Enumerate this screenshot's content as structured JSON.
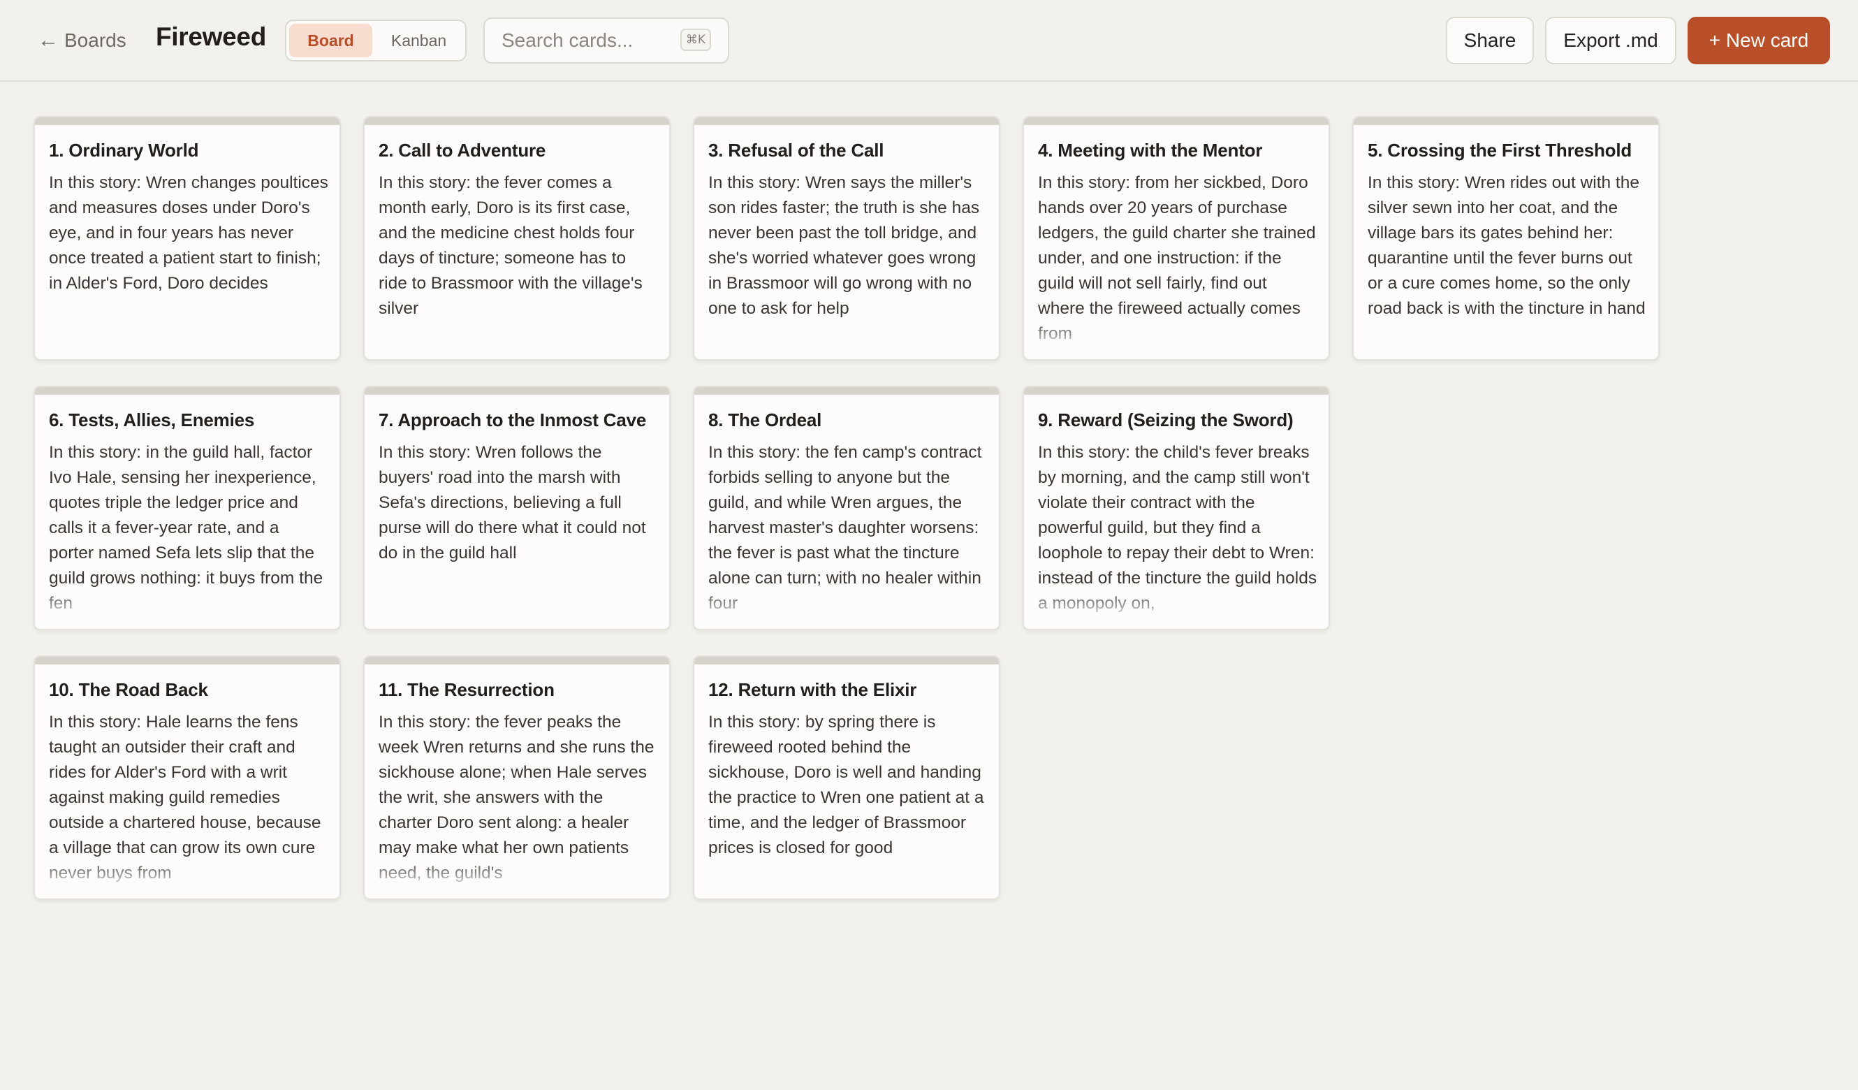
{
  "header": {
    "back_label": "Boards",
    "back_arrow": "←",
    "title": "Fireweed",
    "views": [
      {
        "label": "Board",
        "active": true
      },
      {
        "label": "Kanban",
        "active": false
      }
    ],
    "search_placeholder": "Search cards...",
    "search_shortcut": "⌘K",
    "share_label": "Share",
    "export_label": "Export .md",
    "new_card_label": "+ New card"
  },
  "colors": {
    "accent": "#b94f29",
    "accent_soft": "#f7dccf",
    "background": "#f3f1ed",
    "card": "#fdfcfa",
    "card_stripe": "#d6d3cd"
  },
  "cards": [
    {
      "title": "1. Ordinary World",
      "body": "In this story: Wren changes poultices and measures doses under Doro's eye, and in four years has never once treated a patient start to finish; in Alder's Ford, Doro decides"
    },
    {
      "title": "2. Call to Adventure",
      "body": "In this story: the fever comes a month early, Doro is its first case, and the medicine chest holds four days of tincture; someone has to ride to Brassmoor with the village's silver"
    },
    {
      "title": "3. Refusal of the Call",
      "body": "In this story: Wren says the miller's son rides faster; the truth is she has never been past the toll bridge, and she's worried whatever goes wrong in Brassmoor will go wrong with no one to ask for help"
    },
    {
      "title": "4. Meeting with the Mentor",
      "body": "In this story: from her sickbed, Doro hands over 20 years of purchase ledgers, the guild charter she trained under, and one instruction: if the guild will not sell fairly, find out where the fireweed actually comes from"
    },
    {
      "title": "5. Crossing the First Threshold",
      "body": "In this story: Wren rides out with the silver sewn into her coat, and the village bars its gates behind her: quarantine until the fever burns out or a cure comes home, so the only road back is with the tincture in hand"
    },
    {
      "title": "6. Tests, Allies, Enemies",
      "body": "In this story: in the guild hall, factor Ivo Hale, sensing her inexperience, quotes triple the ledger price and calls it a fever-year rate, and a porter named Sefa lets slip that the guild grows nothing: it buys from the fen"
    },
    {
      "title": "7. Approach to the Inmost Cave",
      "body": "In this story: Wren follows the buyers' road into the marsh with Sefa's directions, believing a full purse will do there what it could not do in the guild hall"
    },
    {
      "title": "8. The Ordeal",
      "body": "In this story: the fen camp's contract forbids selling to anyone but the guild, and while Wren argues, the harvest master's daughter worsens: the fever is past what the tincture alone can turn; with no healer within four"
    },
    {
      "title": "9. Reward (Seizing the Sword)",
      "body": "In this story: the child's fever breaks by morning, and the camp still won't violate their contract with the powerful guild, but they find a loophole to repay their debt to Wren: instead of the tincture the guild holds a monopoly on,"
    },
    {
      "title": "10. The Road Back",
      "body": "In this story: Hale learns the fens taught an outsider their craft and rides for Alder's Ford with a writ against making guild remedies outside a chartered house, because a village that can grow its own cure never buys from"
    },
    {
      "title": "11. The Resurrection",
      "body": "In this story: the fever peaks the week Wren returns and she runs the sickhouse alone; when Hale serves the writ, she answers with the charter Doro sent along: a healer may make what her own patients need, the guild's"
    },
    {
      "title": "12. Return with the Elixir",
      "body": "In this story: by spring there is fireweed rooted behind the sickhouse, Doro is well and handing the practice to Wren one patient at a time, and the ledger of Brassmoor prices is closed for good"
    }
  ]
}
